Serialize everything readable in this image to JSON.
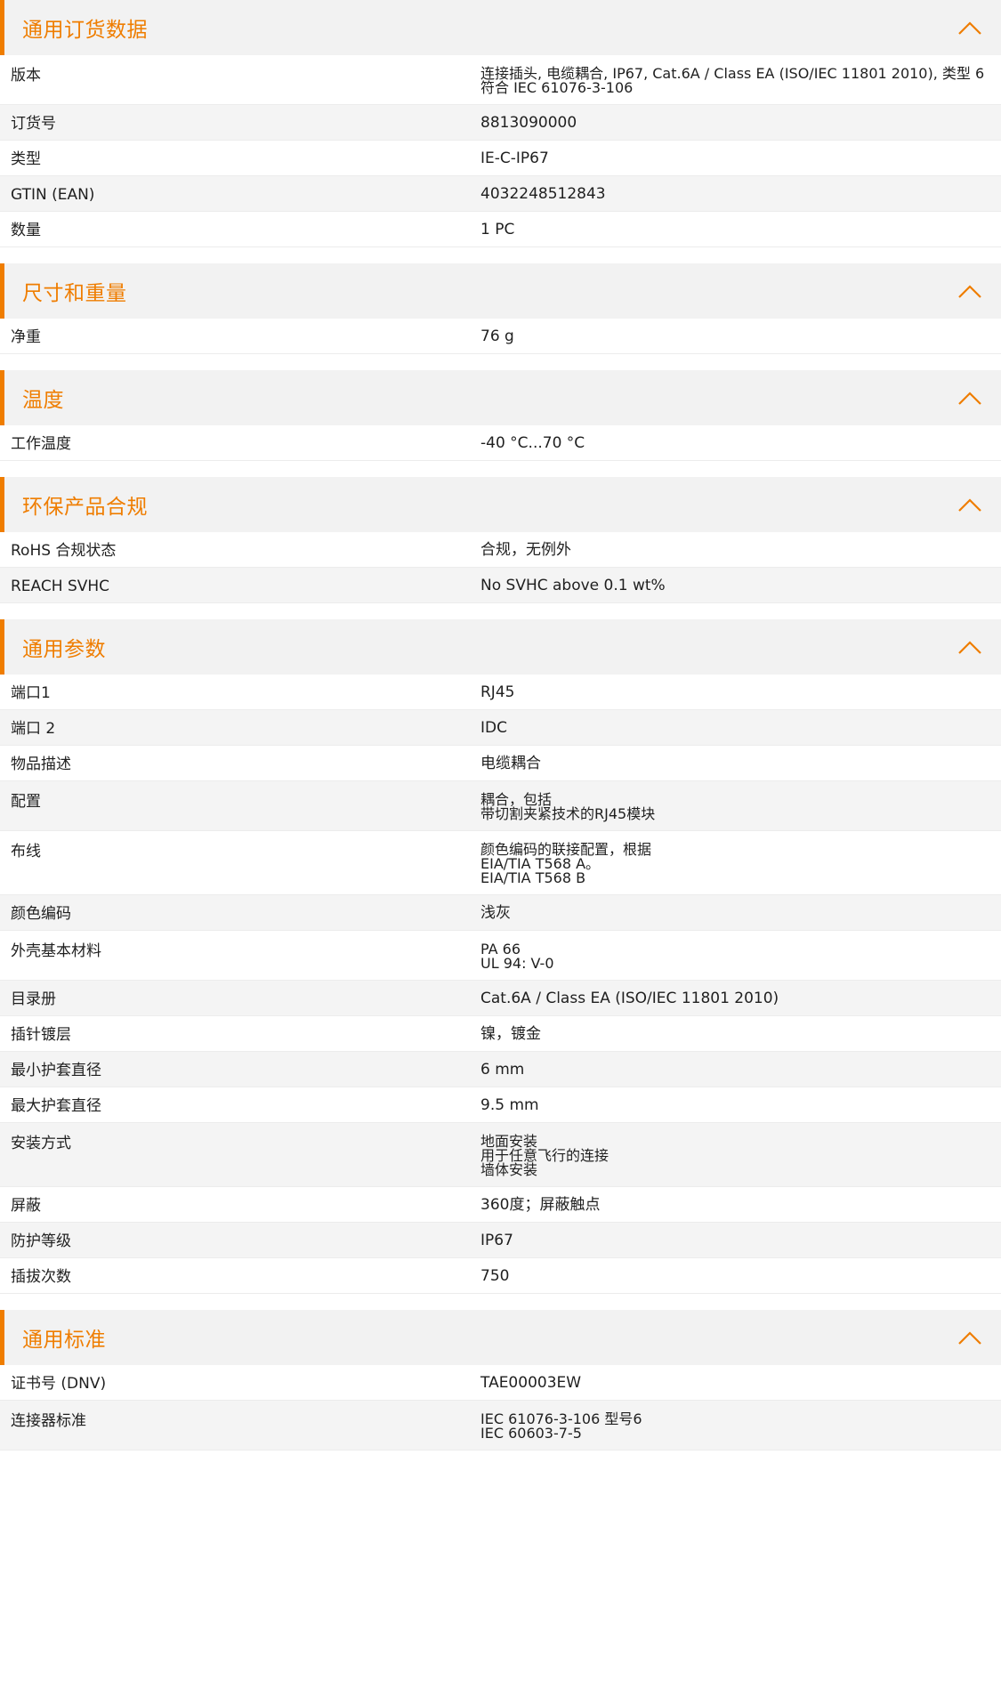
{
  "colors": {
    "accent": "#ef7d00",
    "header_bg": "#f2f2f2",
    "row_alt": "#f4f4f4"
  },
  "icons": {
    "collapse": "chevron-up-icon"
  },
  "sections": [
    {
      "title": "通用订货数据",
      "rows": [
        {
          "key": "版本",
          "value": "连接插头, 电缆耦合, IP67, Cat.6A / Class EA (ISO/IEC 11801 2010), 类型 6 符合 IEC 61076-3-106"
        },
        {
          "key": "订货号",
          "value": "8813090000"
        },
        {
          "key": "类型",
          "value": "IE-C-IP67"
        },
        {
          "key": "GTIN (EAN)",
          "value": "4032248512843"
        },
        {
          "key": "数量",
          "value": "1  PC"
        }
      ]
    },
    {
      "title": "尺寸和重量",
      "rows": [
        {
          "key": "净重",
          "value": "76  g"
        }
      ]
    },
    {
      "title": "温度",
      "rows": [
        {
          "key": "工作温度",
          "value": "-40 °C...70 °C"
        }
      ]
    },
    {
      "title": "环保产品合规",
      "rows": [
        {
          "key": "RoHS 合规状态",
          "value": "合规，无例外"
        },
        {
          "key": "REACH SVHC",
          "value": "No SVHC above 0.1 wt%"
        }
      ]
    },
    {
      "title": "通用参数",
      "rows": [
        {
          "key": "端口1",
          "value": "RJ45"
        },
        {
          "key": "端口 2",
          "value": "IDC"
        },
        {
          "key": "物品描述",
          "value": "电缆耦合"
        },
        {
          "key": "配置",
          "value": "耦合，包括\n带切割夹紧技术的RJ45模块"
        },
        {
          "key": "布线",
          "value": "颜色编码的联接配置，根据\nEIA/TIA T568 A。\nEIA/TIA T568 B"
        },
        {
          "key": "颜色编码",
          "value": "浅灰"
        },
        {
          "key": "外壳基本材料",
          "value": "PA 66\nUL 94: V-0"
        },
        {
          "key": "目录册",
          "value": "Cat.6A / Class EA (ISO/IEC 11801 2010)"
        },
        {
          "key": "插针镀层",
          "value": "镍，镀金"
        },
        {
          "key": "最小护套直径",
          "value": "6  mm"
        },
        {
          "key": "最大护套直径",
          "value": "9.5  mm"
        },
        {
          "key": "安装方式",
          "value": "地面安装\n用于任意飞行的连接\n墙体安装"
        },
        {
          "key": "屏蔽",
          "value": "360度；屏蔽触点"
        },
        {
          "key": "防护等级",
          "value": "IP67"
        },
        {
          "key": "插拔次数",
          "value": "750"
        }
      ]
    },
    {
      "title": "通用标准",
      "rows": [
        {
          "key": "证书号 (DNV)",
          "value": "TAE00003EW"
        },
        {
          "key": "连接器标准",
          "value": "IEC 61076-3-106 型号6\nIEC 60603-7-5"
        }
      ]
    }
  ]
}
